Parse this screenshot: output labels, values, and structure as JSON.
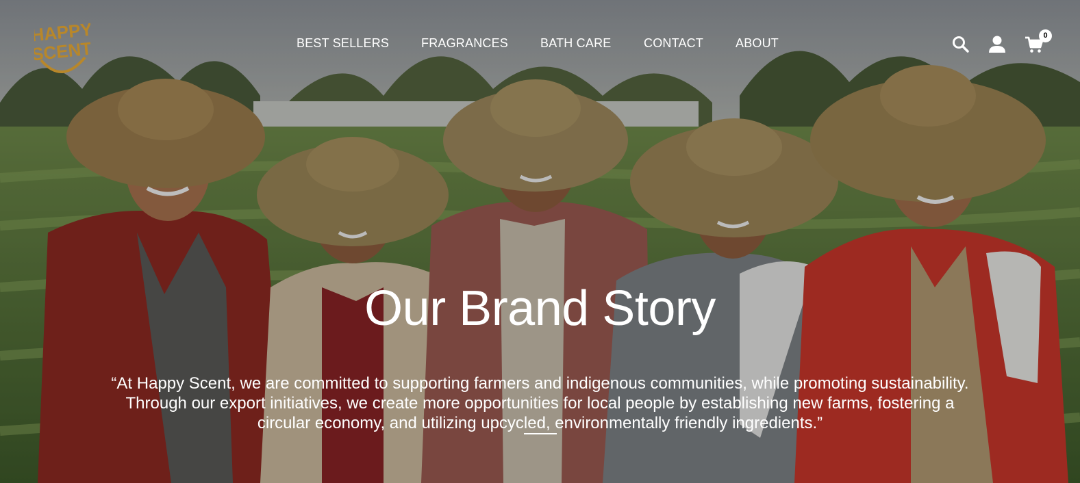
{
  "brand": {
    "name_line1": "HAPPY",
    "name_line2": "SCENT",
    "accent_color": "#b8872a"
  },
  "nav": {
    "items": [
      {
        "label": "BEST SELLERS"
      },
      {
        "label": "FRAGRANCES"
      },
      {
        "label": "BATH CARE"
      },
      {
        "label": "CONTACT"
      },
      {
        "label": "ABOUT"
      }
    ]
  },
  "header_icons": {
    "search": "search-icon",
    "account": "user-icon",
    "cart": "cart-icon",
    "cart_count": "0"
  },
  "hero": {
    "title": "Our Brand Story",
    "quote": "“At Happy Scent, we are committed to supporting farmers and indigenous communities, while promoting sustainability. Through our export initiatives, we create more opportunities for local people by establishing new farms, fostering a circular economy, and utilizing upcycled, environmentally friendly ingredients.”"
  }
}
